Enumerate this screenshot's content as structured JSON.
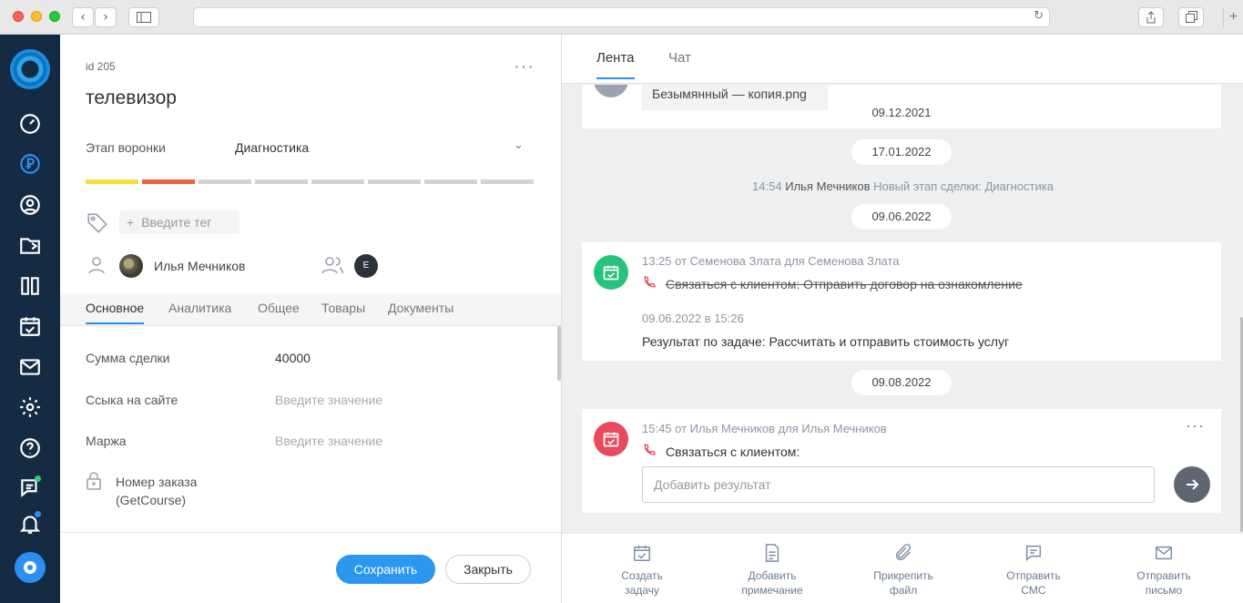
{
  "browser": {
    "back": "‹",
    "forward": "›",
    "reload": "↻",
    "new_tab": "+"
  },
  "colors": {
    "sidebar_bg": "#152a43",
    "accent": "#2b8ff0",
    "stage_yellow": "#f7dc3c",
    "stage_orange": "#f0603a",
    "task_green": "#27c27b",
    "task_red": "#e8495b"
  },
  "sidebar": {
    "items": [
      {
        "icon": "dashboard-icon"
      },
      {
        "icon": "ruble-icon",
        "active": true
      },
      {
        "icon": "user-circle-icon"
      },
      {
        "icon": "folder-icon"
      },
      {
        "icon": "kanban-icon"
      },
      {
        "icon": "calendar-check-icon"
      },
      {
        "icon": "mail-icon"
      },
      {
        "icon": "gear-icon"
      },
      {
        "icon": "help-icon"
      },
      {
        "icon": "chat-icon",
        "badge": "green"
      },
      {
        "icon": "bell-icon",
        "badge": "blue"
      }
    ]
  },
  "deal": {
    "id_label": "id 205",
    "title": "телевизор",
    "stage_label": "Этап воронки",
    "stage_value": "Диагностика",
    "stage_progress": {
      "total": 8,
      "completed": 2
    },
    "tag_placeholder": "Введите тег",
    "tag_plus": "+",
    "owner_name": "Илья Мечников",
    "observer_initial": "E",
    "tabs": [
      "Основное",
      "Аналитика",
      "Общее",
      "Товары",
      "Документы"
    ],
    "fields": [
      {
        "label": "Сумма сделки",
        "value": "40000"
      },
      {
        "label": "Ссыка на сайте",
        "placeholder": "Введите значение"
      },
      {
        "label": "Маржа",
        "placeholder": "Введите значение"
      },
      {
        "label_line1": "Номер заказа",
        "label_line2": "(GetCourse)"
      }
    ],
    "save_label": "Сохранить",
    "close_label": "Закрыть"
  },
  "feed": {
    "tabs": [
      "Лента",
      "Чат"
    ],
    "file_name": "Безымянный — копия.png",
    "date1": "09.12.2021",
    "date2": "17.01.2022",
    "event_time": "14:54",
    "event_user": "Илья Мечников",
    "event_text": "Новый этап сделки: Диагностика",
    "date3": "09.06.2022",
    "task1_meta": "13:25 от Семенова Злата для Семенова Злата",
    "task1_text": "Связаться с клиентом: Отправить договор на ознакомление",
    "task1_done_meta": "09.06.2022 в 15:26",
    "task1_result": "Результат по задаче: Рассчитать и отправить стоимость услуг",
    "date4": "09.08.2022",
    "task2_meta": "15:45 от Илья Мечников для Илья Мечников",
    "task2_text": "Связаться с клиентом:",
    "result_placeholder": "Добавить результат"
  },
  "actions": [
    {
      "line1": "Создать",
      "line2": "задачу",
      "icon": "calendar-check-icon"
    },
    {
      "line1": "Добавить",
      "line2": "примечание",
      "icon": "note-icon"
    },
    {
      "line1": "Прикрепить",
      "line2": "файл",
      "icon": "paperclip-icon"
    },
    {
      "line1": "Отправить",
      "line2": "СМС",
      "icon": "sms-icon"
    },
    {
      "line1": "Отправить",
      "line2": "письмо",
      "icon": "mail-icon"
    }
  ]
}
